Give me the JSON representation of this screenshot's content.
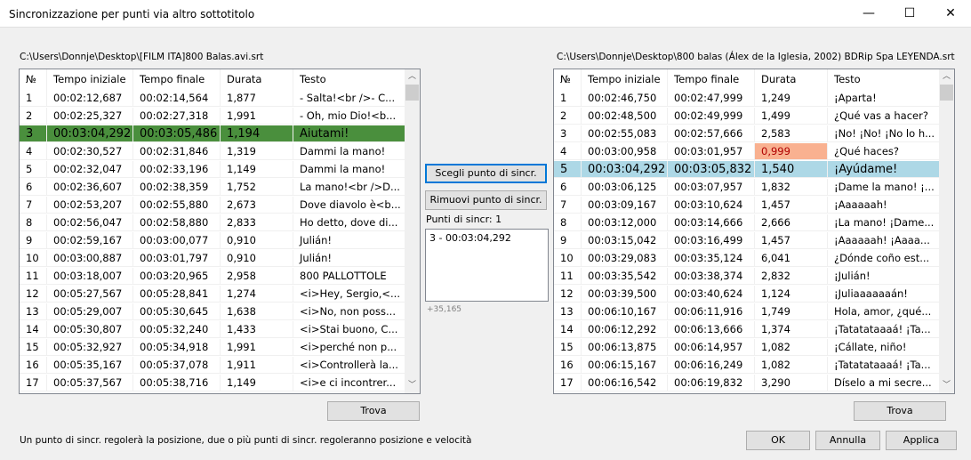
{
  "window": {
    "title": "Sincronizzazione per punti via altro sottotitolo",
    "minimize": "—",
    "maximize": "☐",
    "close": "✕"
  },
  "columns": [
    "№",
    "Tempo iniziale",
    "Tempo finale",
    "Durata",
    "Testo"
  ],
  "left": {
    "path": "C:\\Users\\Donnje\\Desktop\\[FILM ITA]800 Balas.avi.srt",
    "selected_row": 3,
    "rows": [
      [
        "1",
        "00:02:12,687",
        "00:02:14,564",
        "1,877",
        "- Salta!<br />- C..."
      ],
      [
        "2",
        "00:02:25,327",
        "00:02:27,318",
        "1,991",
        "- Oh, mio Dio!<b..."
      ],
      [
        "3",
        "00:03:04,292",
        "00:03:05,486",
        "1,194",
        "Aiutami!"
      ],
      [
        "4",
        "00:02:30,527",
        "00:02:31,846",
        "1,319",
        "Dammi la mano!"
      ],
      [
        "5",
        "00:02:32,047",
        "00:02:33,196",
        "1,149",
        "Dammi la mano!"
      ],
      [
        "6",
        "00:02:36,607",
        "00:02:38,359",
        "1,752",
        "La mano!<br />D..."
      ],
      [
        "7",
        "00:02:53,207",
        "00:02:55,880",
        "2,673",
        "Dove diavolo è<b..."
      ],
      [
        "8",
        "00:02:56,047",
        "00:02:58,880",
        "2,833",
        "Ho detto, dove di..."
      ],
      [
        "9",
        "00:02:59,167",
        "00:03:00,077",
        "0,910",
        "Julián!"
      ],
      [
        "10",
        "00:03:00,887",
        "00:03:01,797",
        "0,910",
        "Julián!"
      ],
      [
        "11",
        "00:03:18,007",
        "00:03:20,965",
        "2,958",
        "800 PALLOTTOLE"
      ],
      [
        "12",
        "00:05:27,567",
        "00:05:28,841",
        "1,274",
        "<i>Hey, Sergio,<..."
      ],
      [
        "13",
        "00:05:29,007",
        "00:05:30,645",
        "1,638",
        "<i>No, non poss..."
      ],
      [
        "14",
        "00:05:30,807",
        "00:05:32,240",
        "1,433",
        "<i>Stai buono, C..."
      ],
      [
        "15",
        "00:05:32,927",
        "00:05:34,918",
        "1,991",
        "<i>perché non p..."
      ],
      [
        "16",
        "00:05:35,167",
        "00:05:37,078",
        "1,911",
        "<i>Controllerà la..."
      ],
      [
        "17",
        "00:05:37,567",
        "00:05:38,716",
        "1,149",
        "<i>e ci incontrer..."
      ]
    ],
    "find": "Trova"
  },
  "right": {
    "path": "C:\\Users\\Donnje\\Desktop\\800 balas (Álex de la Iglesia, 2002) BDRip Spa LEYENDA.srt",
    "selected_row": 5,
    "warning_cell": {
      "row": 4,
      "color": "#f9b190"
    },
    "rows": [
      [
        "1",
        "00:02:46,750",
        "00:02:47,999",
        "1,249",
        "¡Aparta!"
      ],
      [
        "2",
        "00:02:48,500",
        "00:02:49,999",
        "1,499",
        "¿Qué vas a hacer?"
      ],
      [
        "3",
        "00:02:55,083",
        "00:02:57,666",
        "2,583",
        "¡No! ¡No! ¡No lo h..."
      ],
      [
        "4",
        "00:03:00,958",
        "00:03:01,957",
        "0,999",
        "¿Qué haces?"
      ],
      [
        "5",
        "00:03:04,292",
        "00:03:05,832",
        "1,540",
        "¡Ayúdame!"
      ],
      [
        "6",
        "00:03:06,125",
        "00:03:07,957",
        "1,832",
        "¡Dame la mano! ¡..."
      ],
      [
        "7",
        "00:03:09,167",
        "00:03:10,624",
        "1,457",
        "¡Aaaaaah!"
      ],
      [
        "8",
        "00:03:12,000",
        "00:03:14,666",
        "2,666",
        "¡La mano! ¡Dame..."
      ],
      [
        "9",
        "00:03:15,042",
        "00:03:16,499",
        "1,457",
        "¡Aaaaaah! ¡Aaaa..."
      ],
      [
        "10",
        "00:03:29,083",
        "00:03:35,124",
        "6,041",
        "¿Dónde coño est..."
      ],
      [
        "11",
        "00:03:35,542",
        "00:03:38,374",
        "2,832",
        "¡Julián!"
      ],
      [
        "12",
        "00:03:39,500",
        "00:03:40,624",
        "1,124",
        "¡Juliaaaaaaán!"
      ],
      [
        "13",
        "00:06:10,167",
        "00:06:11,916",
        "1,749",
        "Hola, amor, ¿qué..."
      ],
      [
        "14",
        "00:06:12,292",
        "00:06:13,666",
        "1,374",
        "¡Tatatataaaá! ¡Ta..."
      ],
      [
        "15",
        "00:06:13,875",
        "00:06:14,957",
        "1,082",
        "¡Cállate, niño!"
      ],
      [
        "16",
        "00:06:15,167",
        "00:06:16,249",
        "1,082",
        "¡Tatatataaaá! ¡Ta..."
      ],
      [
        "17",
        "00:06:16,542",
        "00:06:19,832",
        "3,290",
        "Díselo a mi secre..."
      ]
    ],
    "find": "Trova"
  },
  "middle": {
    "choose": "Scegli punto di sincr.",
    "remove": "Rimuovi punto di sincr.",
    "count_label": "Punti di sincr: 1",
    "points": [
      "3 - 00:03:04,292"
    ],
    "offset": "+35,165"
  },
  "footer": {
    "hint": "Un punto di sincr. regolerà la posizione, due o più punti di sincr. regoleranno posizione e velocità",
    "ok": "OK",
    "cancel": "Annulla",
    "apply": "Applica"
  },
  "colors": {
    "left_selected": "#4a8f3d",
    "right_selected": "#add8e6"
  }
}
